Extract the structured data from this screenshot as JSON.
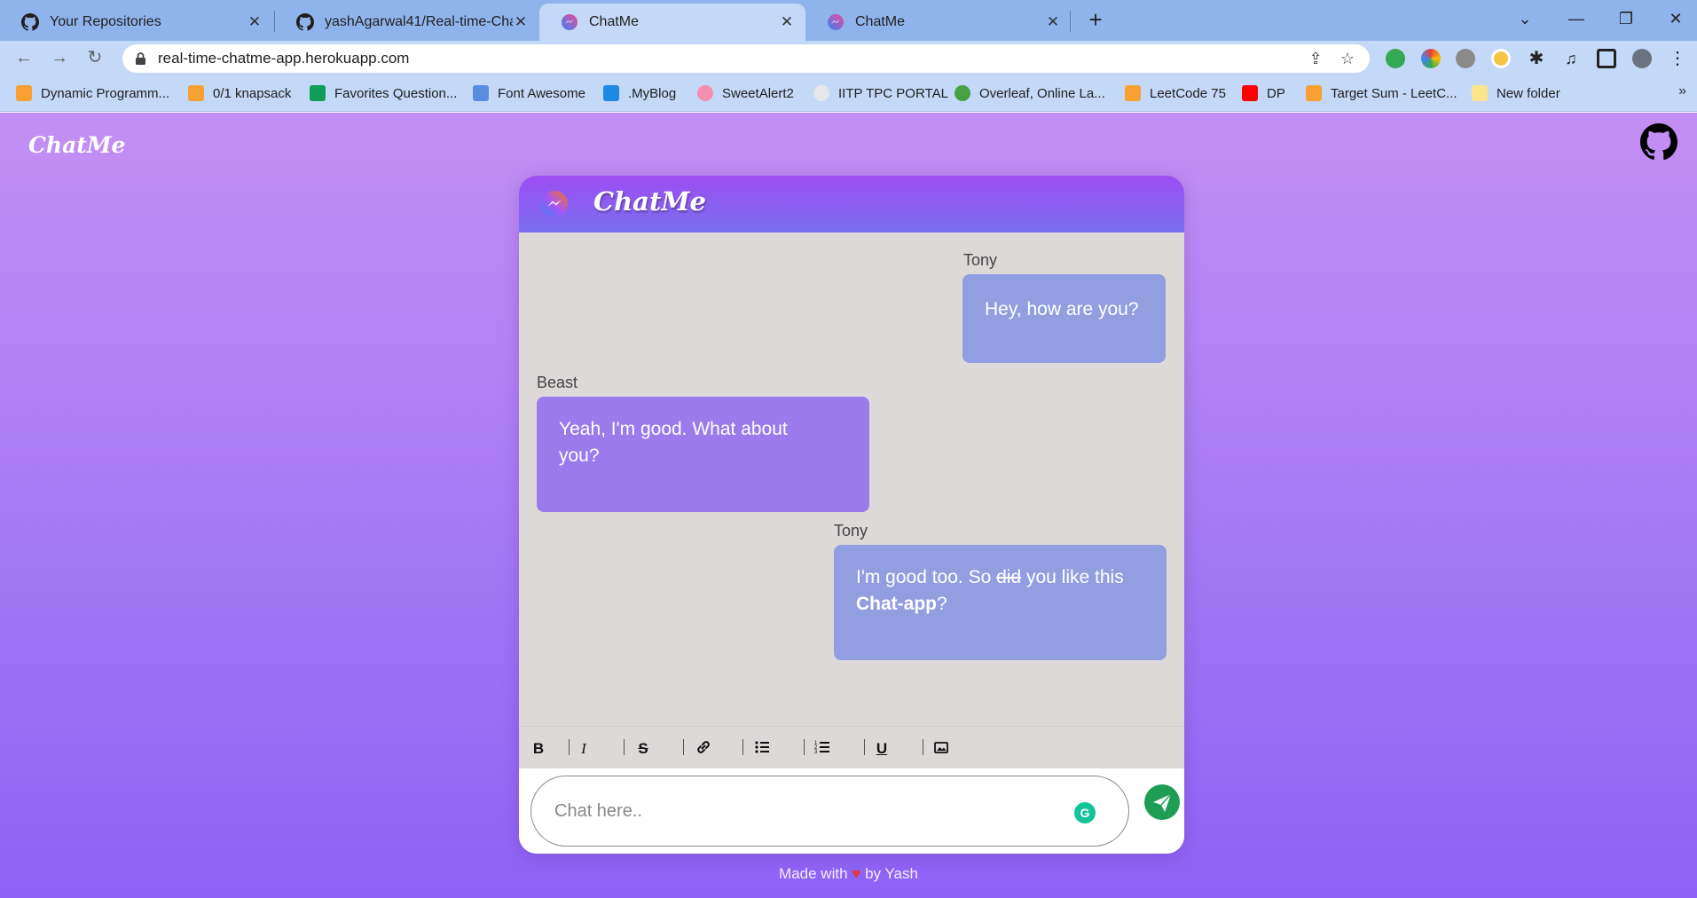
{
  "browser": {
    "tabs": [
      {
        "title": "Your Repositories",
        "active": false
      },
      {
        "title": "yashAgarwal41/Real-time-Chat-a",
        "active": false
      },
      {
        "title": "ChatMe",
        "active": true
      },
      {
        "title": "ChatMe",
        "active": false
      }
    ],
    "url": "real-time-chatme-app.herokuapp.com",
    "bookmarks": [
      {
        "label": "Dynamic Programm...",
        "icon": "leetcode-icon"
      },
      {
        "label": "0/1 knapsack",
        "icon": "leetcode-icon"
      },
      {
        "label": "Favorites Question...",
        "icon": "sheets-icon"
      },
      {
        "label": "Font Awesome",
        "icon": "flag-icon"
      },
      {
        "label": ".MyBlog",
        "icon": "blogger-icon"
      },
      {
        "label": "SweetAlert2",
        "icon": "sweetalert-icon"
      },
      {
        "label": "IITP TPC PORTAL",
        "icon": "iitp-icon"
      },
      {
        "label": "Overleaf, Online La...",
        "icon": "overleaf-icon"
      },
      {
        "label": "LeetCode 75",
        "icon": "leetcode-icon"
      },
      {
        "label": "DP",
        "icon": "youtube-icon"
      },
      {
        "label": "Target Sum - LeetC...",
        "icon": "leetcode-icon"
      },
      {
        "label": "New folder",
        "icon": "folder-icon"
      }
    ],
    "bookmarks_more": "»"
  },
  "page": {
    "brand": "ChatMe",
    "chat": {
      "title": "ChatMe",
      "messages": [
        {
          "sender": "Tony",
          "text": "Hey, how are you?",
          "mine": true
        },
        {
          "sender": "Beast",
          "line1": "Yeah, I'm good. What about",
          "line2": "you?",
          "mine": false
        },
        {
          "sender": "Tony",
          "part1": "I'm good too. So ",
          "strike": "did",
          "part2": " you like this",
          "bold": "Chat-app",
          "part3": "?",
          "mine": true
        }
      ],
      "input_placeholder": "Chat here..",
      "grammarly_glyph": "G"
    },
    "footer": {
      "prefix": "Made with ",
      "heart": "♥",
      "suffix": " by Yash"
    }
  },
  "colors": {
    "page_gradient_top": "#c48ff4",
    "page_gradient_bottom": "#8d62f5",
    "header_gradient": "#9d4df2",
    "bubble_mine": "#919fe0",
    "bubble_theirs": "#9b7aec",
    "send_button": "#1f9d55"
  }
}
